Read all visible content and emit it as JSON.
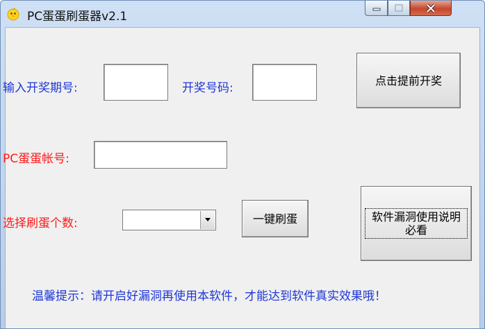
{
  "window": {
    "title": "PC蛋蛋刷蛋器v2.1",
    "icon": "chick-icon",
    "controls": [
      "minimize-icon",
      "maximize-icon",
      "close-icon"
    ]
  },
  "form": {
    "period_label": "输入开奖期号:",
    "period_value": "",
    "number_label": "开奖号码:",
    "number_value": "",
    "account_label": "PC蛋蛋帐号:",
    "account_value": "",
    "count_label": "选择刷蛋个数:",
    "count_selected": ""
  },
  "buttons": {
    "advance_draw": "点击提前开奖",
    "one_click": "一键刷蛋",
    "instructions": "软件漏洞使用说明必看"
  },
  "tip": "温馨提示：请开启好漏洞再使用本软件，才能达到软件真实效果哦！",
  "colors": {
    "label_blue": "#1f37d6",
    "label_red": "#ff1a1a",
    "client_bg": "#f0f0f0"
  }
}
